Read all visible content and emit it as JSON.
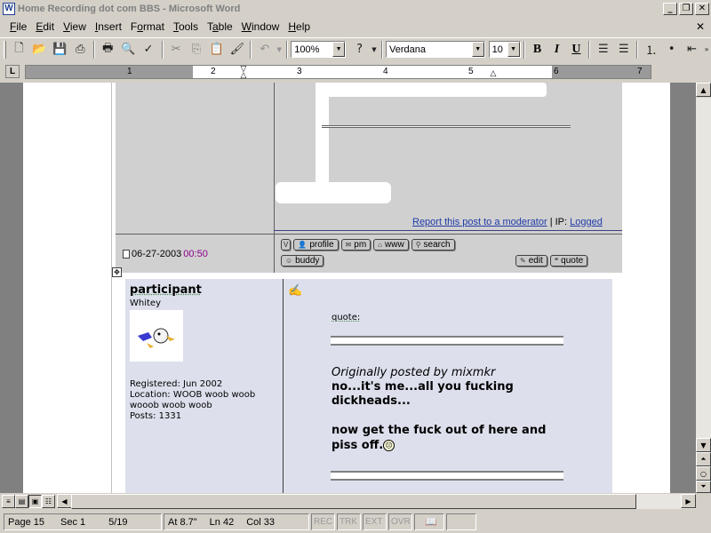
{
  "window": {
    "title": "Home Recording dot com BBS - Microsoft Word",
    "app_icon_letter": "W",
    "minimize_glyph": "_",
    "restore_glyph": "❐",
    "close_glyph": "✕"
  },
  "menu": [
    "File",
    "Edit",
    "View",
    "Insert",
    "Format",
    "Tools",
    "Table",
    "Window",
    "Help"
  ],
  "menu_underline": [
    "F",
    "E",
    "V",
    "I",
    "o",
    "T",
    "a",
    "W",
    "H"
  ],
  "doc_close_glyph": "✕",
  "toolbar": {
    "zoom": "100%",
    "font": "Verdana",
    "font_size": "10",
    "bold": "B",
    "italic": "I",
    "underline": "U"
  },
  "ruler": {
    "corner": "L",
    "numbers": [
      "1",
      "1",
      "2",
      "3",
      "4",
      "5",
      "6",
      "7"
    ]
  },
  "post1": {
    "report_link": "Report this post to a moderator",
    "ip_label": "| IP:",
    "ip_link": "Logged",
    "date": "06-27-2003",
    "time": "00:50",
    "buttons": [
      "profile",
      "pm",
      "www",
      "search",
      "buddy"
    ],
    "edit": "edit",
    "quote": "quote"
  },
  "post2": {
    "poster_name": "participant",
    "poster_title": "Whitey",
    "registered": "Registered: Jun 2002",
    "location": "Location: WOOB woob woob wooob woob woob",
    "posts": "Posts: 1331",
    "quote_label": "quote:",
    "originally_posted": "Originally posted by mixmkr",
    "quoted_text": "no...it's me...all you fucking dickheads...",
    "reply_text": "now get the fuck out of here and piss off."
  },
  "statusbar": {
    "page": "Page 15",
    "sec": "Sec 1",
    "pages": "5/19",
    "at": "At 8.7\"",
    "ln": "Ln 42",
    "col": "Col 33",
    "rec": "REC",
    "trk": "TRK",
    "ext": "EXT",
    "ovr": "OVR"
  }
}
